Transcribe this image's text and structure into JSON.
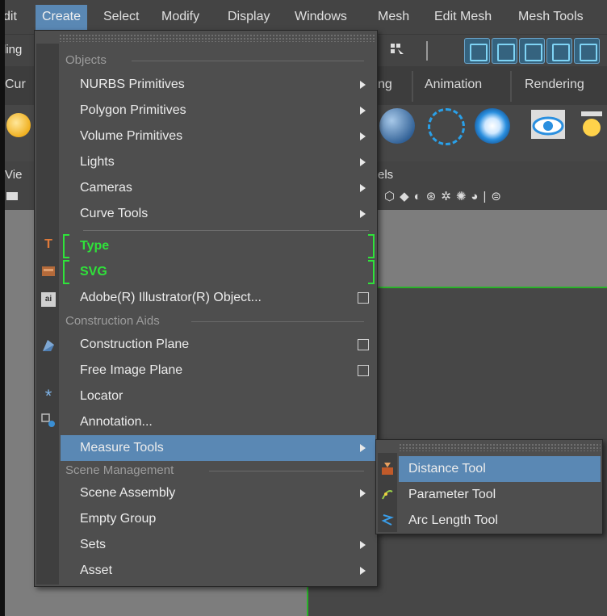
{
  "menubar": {
    "items": [
      "dit",
      "Create",
      "Select",
      "Modify",
      "Display",
      "Windows",
      "Mesh",
      "Edit Mesh",
      "Mesh Tools"
    ]
  },
  "shelf": {
    "left_field": "ling",
    "tab_left": "Cur",
    "tab_rigging_fragment": "ng",
    "tab_animation": "Animation",
    "tab_rendering": "Rendering",
    "view_label": "Vie",
    "panels_fragment": "els"
  },
  "menu": {
    "sections": {
      "objects": "Objects",
      "construction_aids": "Construction Aids",
      "scene_management": "Scene Management"
    },
    "items": {
      "nurbs": "NURBS Primitives",
      "polygon": "Polygon Primitives",
      "volume": "Volume Primitives",
      "lights": "Lights",
      "cameras": "Cameras",
      "curve_tools": "Curve Tools",
      "type": "Type",
      "svg": "SVG",
      "illustrator": "Adobe(R) Illustrator(R) Object...",
      "construction_plane": "Construction Plane",
      "free_image_plane": "Free Image Plane",
      "locator": "Locator",
      "annotation": "Annotation...",
      "measure_tools": "Measure Tools",
      "scene_assembly": "Scene Assembly",
      "empty_group": "Empty Group",
      "sets": "Sets",
      "asset": "Asset"
    },
    "icons": {
      "type": "text-icon",
      "svg": "svg-icon",
      "illustrator": "ai-icon",
      "construction_plane": "plane-icon",
      "locator": "locator-icon",
      "annotation": "annotation-icon"
    }
  },
  "submenu": {
    "items": {
      "distance": "Distance Tool",
      "parameter": "Parameter Tool",
      "arc_length": "Arc Length Tool"
    }
  },
  "colors": {
    "highlight": "#5a88b4",
    "green_label": "#2fe33a",
    "menu_bg": "#4e4e4e"
  }
}
